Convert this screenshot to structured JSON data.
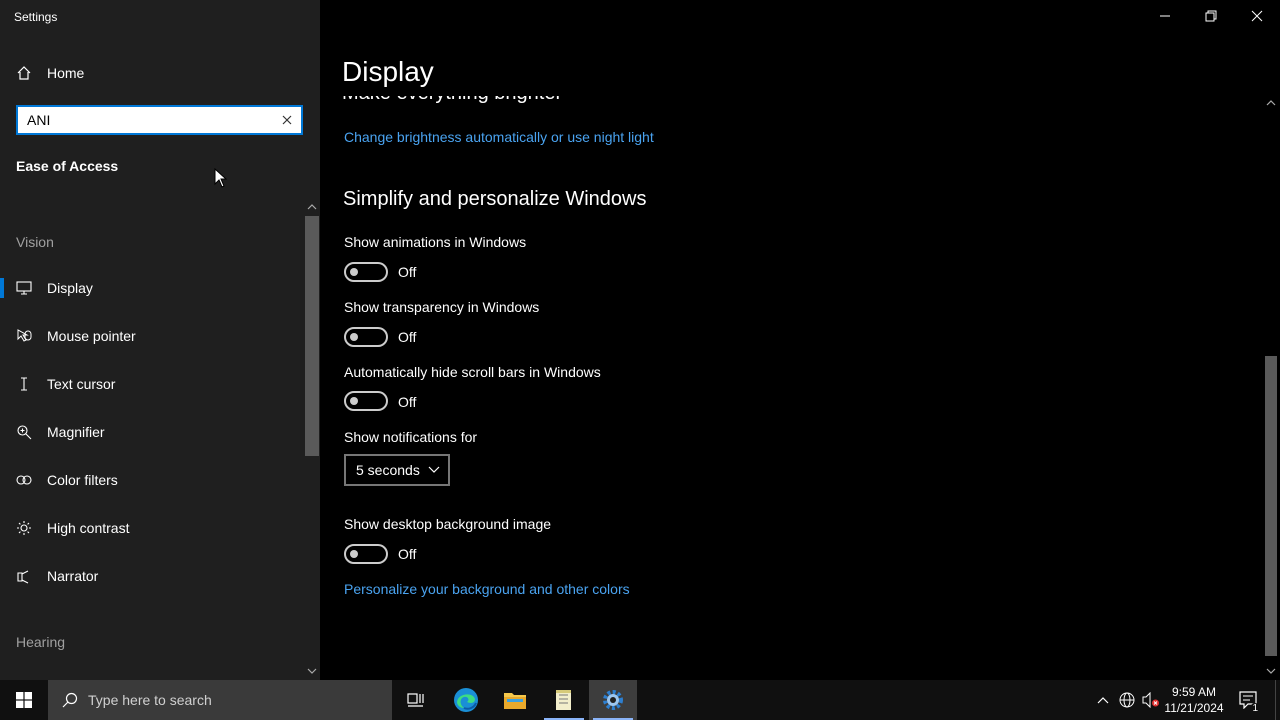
{
  "app": {
    "title": "Settings"
  },
  "sidebar": {
    "home_label": "Home",
    "search": {
      "value": "ANI",
      "placeholder": ""
    },
    "section_heading": "Ease of Access",
    "groups": [
      {
        "label": "Vision"
      },
      {
        "label": "Hearing"
      }
    ],
    "items": [
      {
        "label": "Display",
        "icon": "monitor-icon",
        "selected": true
      },
      {
        "label": "Mouse pointer",
        "icon": "mouse-pointer-icon"
      },
      {
        "label": "Text cursor",
        "icon": "text-cursor-icon"
      },
      {
        "label": "Magnifier",
        "icon": "magnifier-icon"
      },
      {
        "label": "Color filters",
        "icon": "color-filters-icon"
      },
      {
        "label": "High contrast",
        "icon": "high-contrast-icon"
      },
      {
        "label": "Narrator",
        "icon": "narrator-icon"
      }
    ]
  },
  "main": {
    "page_title": "Display",
    "cut_heading": "Make everything brighter",
    "brightness_link": "Change brightness automatically or use night light",
    "section_title": "Simplify and personalize Windows",
    "settings": [
      {
        "label": "Show animations in Windows",
        "state": "Off"
      },
      {
        "label": "Show transparency in Windows",
        "state": "Off"
      },
      {
        "label": "Automatically hide scroll bars in Windows",
        "state": "Off"
      }
    ],
    "notifications": {
      "label": "Show notifications for",
      "value": "5 seconds"
    },
    "background": {
      "label": "Show desktop background image",
      "state": "Off"
    },
    "personalize_link": "Personalize your background and other colors"
  },
  "taskbar": {
    "search_placeholder": "Type here to search",
    "time": "9:59 AM",
    "date": "11/21/2024",
    "notification_count": "1"
  },
  "colors": {
    "accent": "#0078d7",
    "link": "#4aa3f0",
    "sidebar_bg": "#1f1f1f",
    "main_bg": "#000000",
    "taskbar_bg": "#101010"
  }
}
